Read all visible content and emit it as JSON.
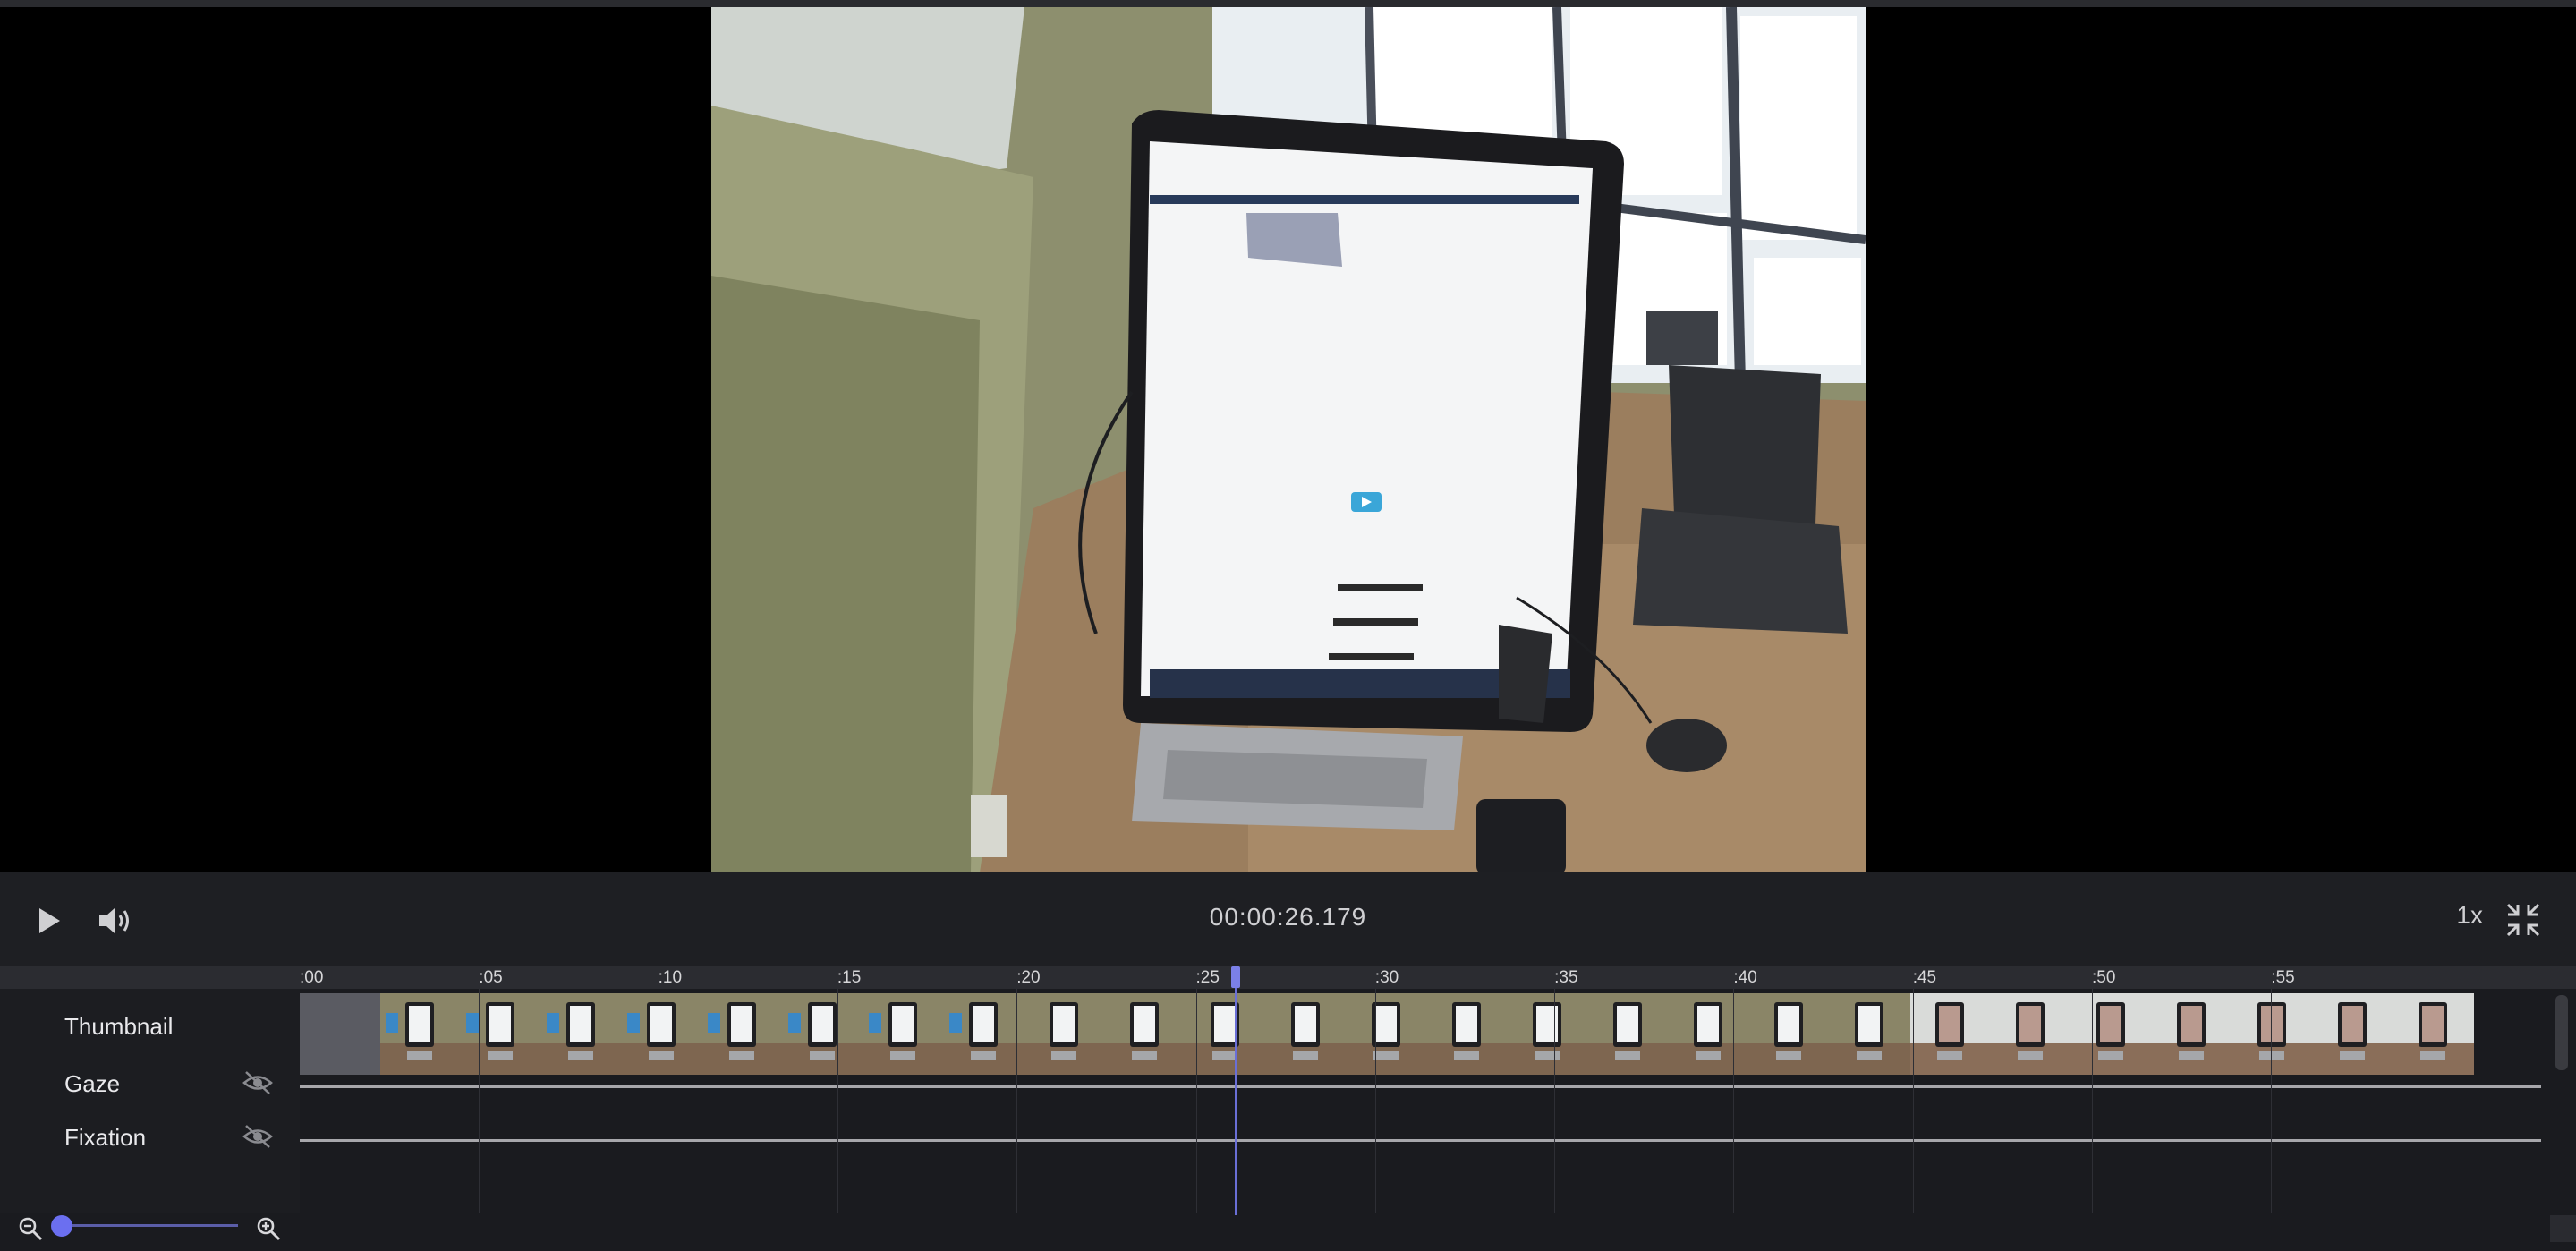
{
  "player": {
    "timecode": "00:00:26.179",
    "speed_label": "1x",
    "icons": {
      "play": "play-icon",
      "volume": "volume-icon",
      "fullscreen": "exit-fullscreen-icon"
    }
  },
  "timeline": {
    "tick_labels": [
      ":00",
      ":05",
      ":10",
      ":15",
      ":20",
      ":25",
      ":30",
      ":35",
      ":40",
      ":45",
      ":50",
      ":55"
    ],
    "playhead_seconds": 26.179,
    "rows": [
      {
        "label": "Thumbnail"
      },
      {
        "label": "Gaze",
        "visibility_icon": "eye-off-icon"
      },
      {
        "label": "Fixation",
        "visibility_icon": "eye-off-icon"
      }
    ]
  },
  "zoom": {
    "zoom_out_icon": "zoom-out-icon",
    "zoom_in_icon": "zoom-in-icon",
    "level": 0
  },
  "colors": {
    "accent": "#6b6ff0",
    "background": "#1a1b1f",
    "controls_bg": "#1e1f23"
  }
}
